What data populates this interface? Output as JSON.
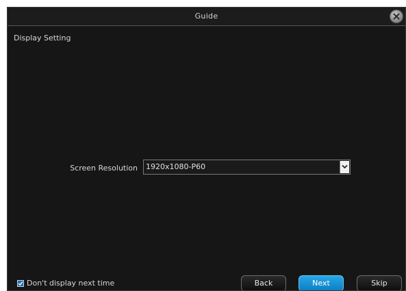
{
  "window": {
    "title": "Guide"
  },
  "section": {
    "title": "Display Setting"
  },
  "resolution": {
    "label": "Screen Resolution",
    "value": "1920x1080-P60"
  },
  "footer": {
    "checkbox_label": "Don't display next time",
    "checkbox_checked": true,
    "back_label": "Back",
    "next_label": "Next",
    "skip_label": "Skip"
  },
  "colors": {
    "background": "#161616",
    "accent": "#1495d8",
    "text": "#d8d8d8"
  },
  "icons": {
    "close": "close-icon",
    "dropdown": "chevron-down-icon",
    "checkbox": "checkmark-icon"
  }
}
